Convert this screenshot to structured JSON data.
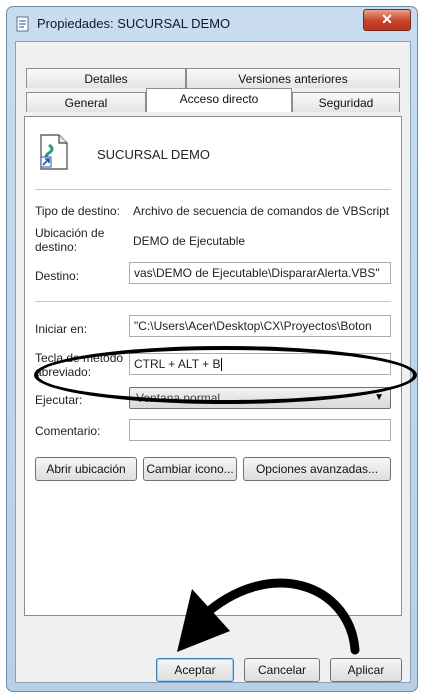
{
  "window": {
    "title": "Propiedades: SUCURSAL DEMO",
    "close_icon": "close-icon",
    "app_icon": "script-file-icon"
  },
  "tabs": {
    "row1": [
      {
        "label": "Detalles"
      },
      {
        "label": "Versiones anteriores"
      }
    ],
    "row2": [
      {
        "label": "General"
      },
      {
        "label": "Acceso directo",
        "active": true
      },
      {
        "label": "Seguridad"
      }
    ]
  },
  "shortcut": {
    "name": "SUCURSAL DEMO",
    "icon": "vbscript-file-icon",
    "target_type_label": "Tipo de destino:",
    "target_type_value": "Archivo de secuencia de comandos de VBScript",
    "target_location_label": "Ubicación de destino:",
    "target_location_value": "DEMO de Ejecutable",
    "target_label": "Destino:",
    "target_value": "vas\\DEMO de Ejecutable\\DispararAlerta.VBS\"",
    "start_in_label": "Iniciar en:",
    "start_in_value": "\"C:\\Users\\Acer\\Desktop\\CX\\Proyectos\\Boton",
    "hotkey_label": "Tecla de método abreviado:",
    "hotkey_value": "CTRL + ALT + B",
    "run_label": "Ejecutar:",
    "run_value": "Ventana normal",
    "comment_label": "Comentario:",
    "comment_value": ""
  },
  "actions": {
    "open_location": "Abrir ubicación",
    "change_icon": "Cambiar icono...",
    "advanced": "Opciones avanzadas..."
  },
  "footer": {
    "ok": "Aceptar",
    "cancel": "Cancelar",
    "apply": "Aplicar"
  },
  "annotations": {
    "highlight_color": "#000000",
    "arrow_color": "#000000"
  }
}
